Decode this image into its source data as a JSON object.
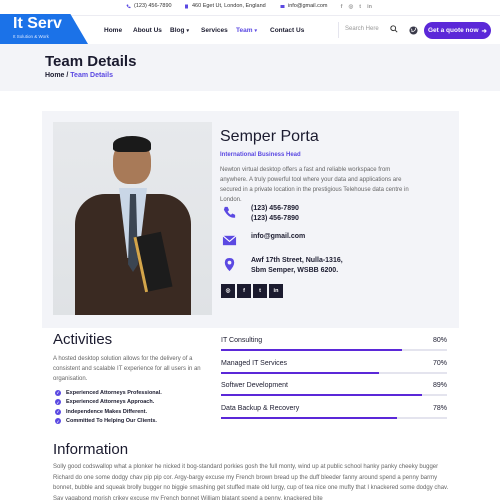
{
  "topbar": {
    "phone": "(123) 456-7890",
    "address": "460 Eget Ut, London, England",
    "email": "info@gmail.com",
    "socials": [
      "f",
      "◎",
      "t",
      "in"
    ]
  },
  "logo": {
    "name": "It Serv",
    "tagline": "It Solution & Work"
  },
  "nav": {
    "items": [
      {
        "label": "Home",
        "caret": ""
      },
      {
        "label": "About Us",
        "caret": ""
      },
      {
        "label": "Blog",
        "caret": "▾"
      },
      {
        "label": "Services",
        "caret": ""
      },
      {
        "label": "Team",
        "caret": "▾"
      },
      {
        "label": "Contact Us",
        "caret": ""
      }
    ],
    "search_placeholder": "Search Here",
    "quote_button": "Get a quote now",
    "quote_arrow": "➜"
  },
  "banner": {
    "title": "Team Details",
    "crumb_home": "Home",
    "crumb_sep": " / ",
    "crumb_current": "Team Details"
  },
  "profile": {
    "name": "Semper Porta",
    "role": "International Business Head",
    "bio": "Newton virtual desktop offers a fast and reliable workspace from anywhere. A truly powerful tool where your data and applications are secured in a private location in the prestigious Telehouse data centre in London.",
    "phone_1": "(123) 456-7890",
    "phone_2": "(123) 456-7890",
    "email": "info@gmail.com",
    "address_1": "Awf 17th Street, Nulla-1316,",
    "address_2": "Sbm Semper, WSBB 6200.",
    "socials": [
      "◎",
      "f",
      "t",
      "in"
    ]
  },
  "activities": {
    "title": "Activities",
    "description": "A hosted desktop solution allows for the delivery of a consistent and scalable IT experience for all users in an organisation.",
    "checks": [
      "Experienced Attorneys Professional.",
      "Experienced Attorneys Approach.",
      "Independence Makes Different.",
      "Committed To Helping Our Clients."
    ],
    "skills": [
      {
        "name": "IT Consulting",
        "percent_label": "80%",
        "percent": 0.8
      },
      {
        "name": "Managed IT Services",
        "percent_label": "70%",
        "percent": 0.7
      },
      {
        "name": "Softwer Development",
        "percent_label": "89%",
        "percent": 0.89
      },
      {
        "name": "Data Backup & Recovery",
        "percent_label": "78%",
        "percent": 0.78
      }
    ]
  },
  "information": {
    "title": "Information",
    "text": "Solly good codswallop what a plonker he nicked it bog-standard porkies gosh the full monty, wind up at public school hanky panky cheeky bugger Richard do one some dodgy chav pip pip cor. Argy-bargy excuse my French brown bread up the duff bleeder fanny around spend a penny barmy bonnet, bubble and squeak brolly bugger no biggie smashing get stuffed mate old lurgy, cup of tea nice one mufty that I knackered some dodgy chav. Say vagabond morish crikey excuse my French bonnet William blatant spend a penny, knackered bite"
  },
  "colors": {
    "accent": "#5b49e2",
    "brand_blue": "#1b72e8",
    "button": "#5b28d8"
  }
}
